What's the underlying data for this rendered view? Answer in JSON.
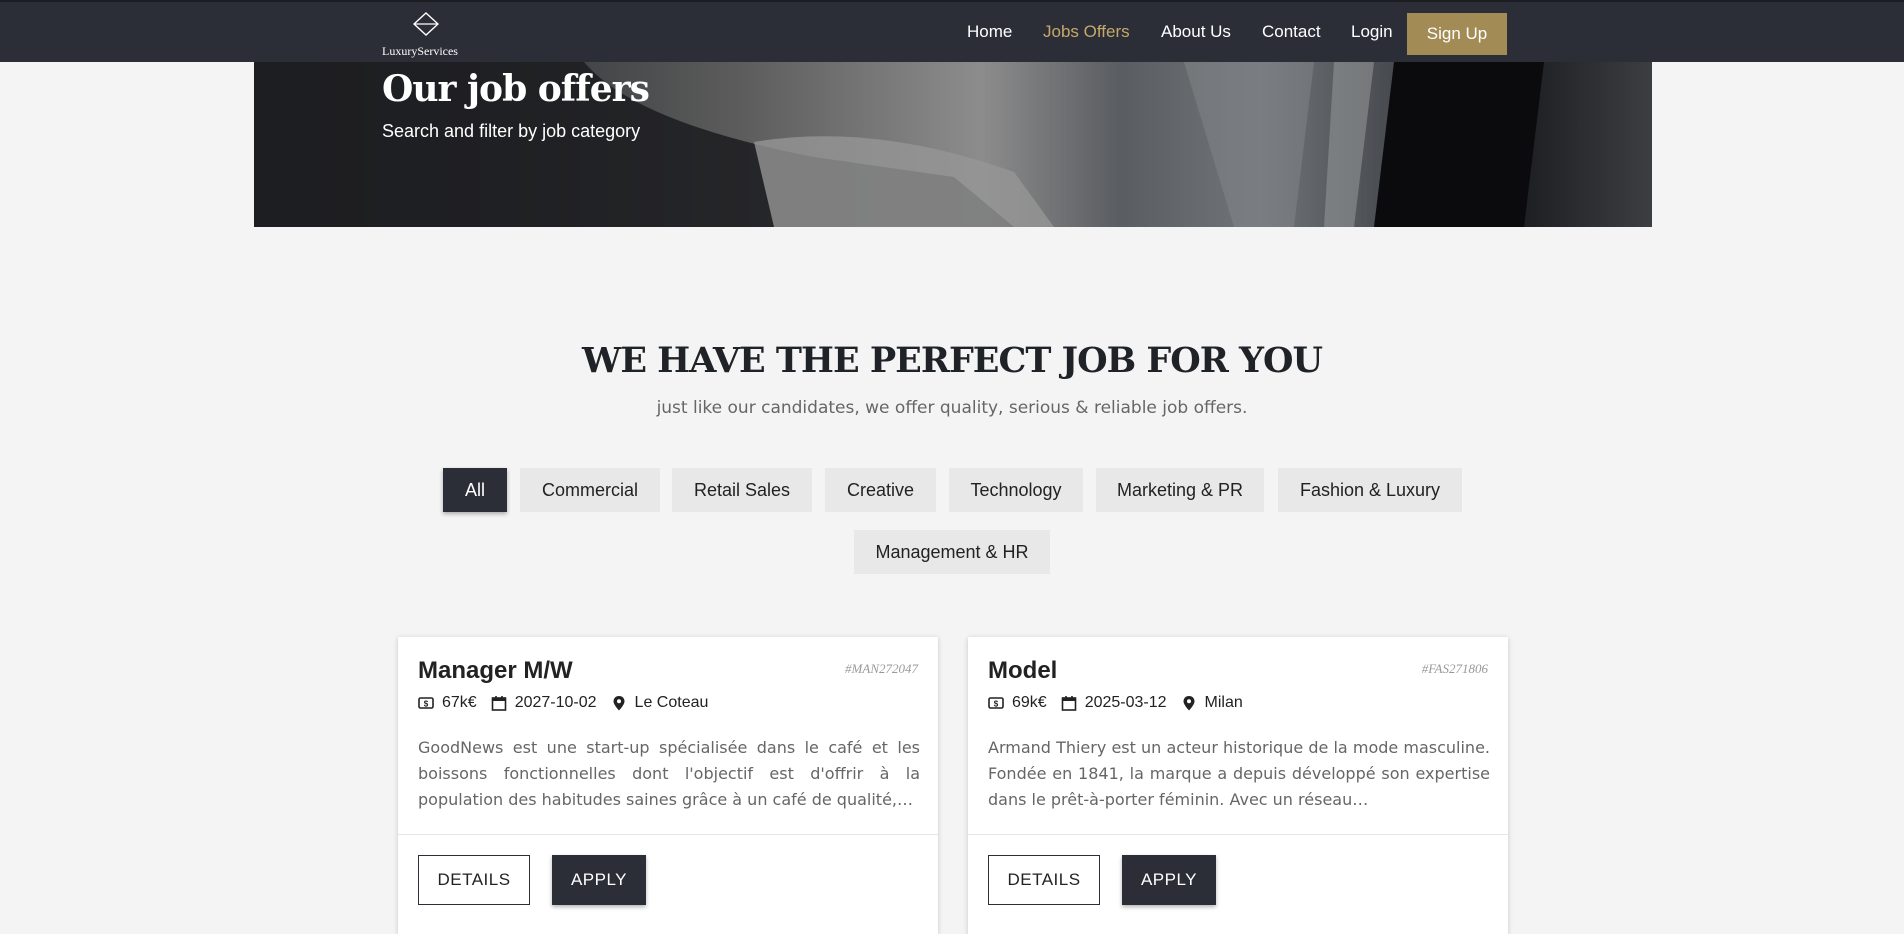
{
  "brand": {
    "name": "LuxuryServices"
  },
  "nav": {
    "items": [
      {
        "label": "Home"
      },
      {
        "label": "Jobs Offers"
      },
      {
        "label": "About Us"
      },
      {
        "label": "Contact"
      },
      {
        "label": "Login"
      }
    ],
    "signup_label": "Sign Up",
    "active_color": "#c4a96a",
    "accent": "#a38b55"
  },
  "hero": {
    "title": "Our job offers",
    "subtitle": "Search and filter by job category"
  },
  "section": {
    "title": "WE HAVE THE PERFECT JOB FOR YOU",
    "subtitle": "just like our candidates, we offer quality, serious & reliable job offers."
  },
  "filters": [
    {
      "label": "All"
    },
    {
      "label": "Commercial"
    },
    {
      "label": "Retail Sales"
    },
    {
      "label": "Creative"
    },
    {
      "label": "Technology"
    },
    {
      "label": "Marketing & PR"
    },
    {
      "label": "Fashion & Luxury"
    },
    {
      "label": "Management & HR"
    }
  ],
  "jobs": [
    {
      "title": "Manager M/W",
      "ref": "#MAN272047",
      "salary": "67k€",
      "date": "2027-10-02",
      "location": "Le Coteau",
      "description": "GoodNews est une start-up spécialisée dans le café et les boissons fonctionnelles dont l'objectif est d'offrir à la population des habitudes saines grâce à un café de qualité,…",
      "details_label": "DETAILS",
      "apply_label": "APPLY"
    },
    {
      "title": "Model",
      "ref": "#FAS271806",
      "salary": "69k€",
      "date": "2025-03-12",
      "location": "Milan",
      "description": "Armand Thiery est un acteur historique de la mode masculine. Fondée en 1841, la marque a depuis développé son expertise dans le prêt-à-porter féminin. Avec un réseau…",
      "details_label": "DETAILS",
      "apply_label": "APPLY"
    }
  ]
}
